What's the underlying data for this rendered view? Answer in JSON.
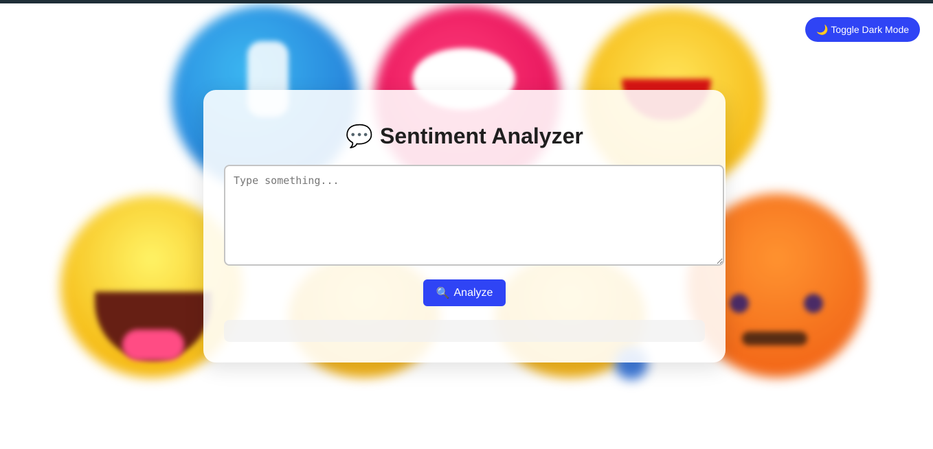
{
  "header": {
    "toggle_icon": "🌙",
    "toggle_icon_name": "moon-icon",
    "toggle_label": "Toggle Dark Mode"
  },
  "card": {
    "title_icon": "💬",
    "title_icon_name": "speech-bubble-icon",
    "title": "Sentiment Analyzer",
    "input_placeholder": "Type something...",
    "input_value": "",
    "analyze_icon": "🔍",
    "analyze_icon_name": "magnifier-icon",
    "analyze_label": "Analyze",
    "result_text": ""
  },
  "colors": {
    "accent": "#2f44f5",
    "topbar": "#1f2f38",
    "card_bg": "#ffffff"
  }
}
